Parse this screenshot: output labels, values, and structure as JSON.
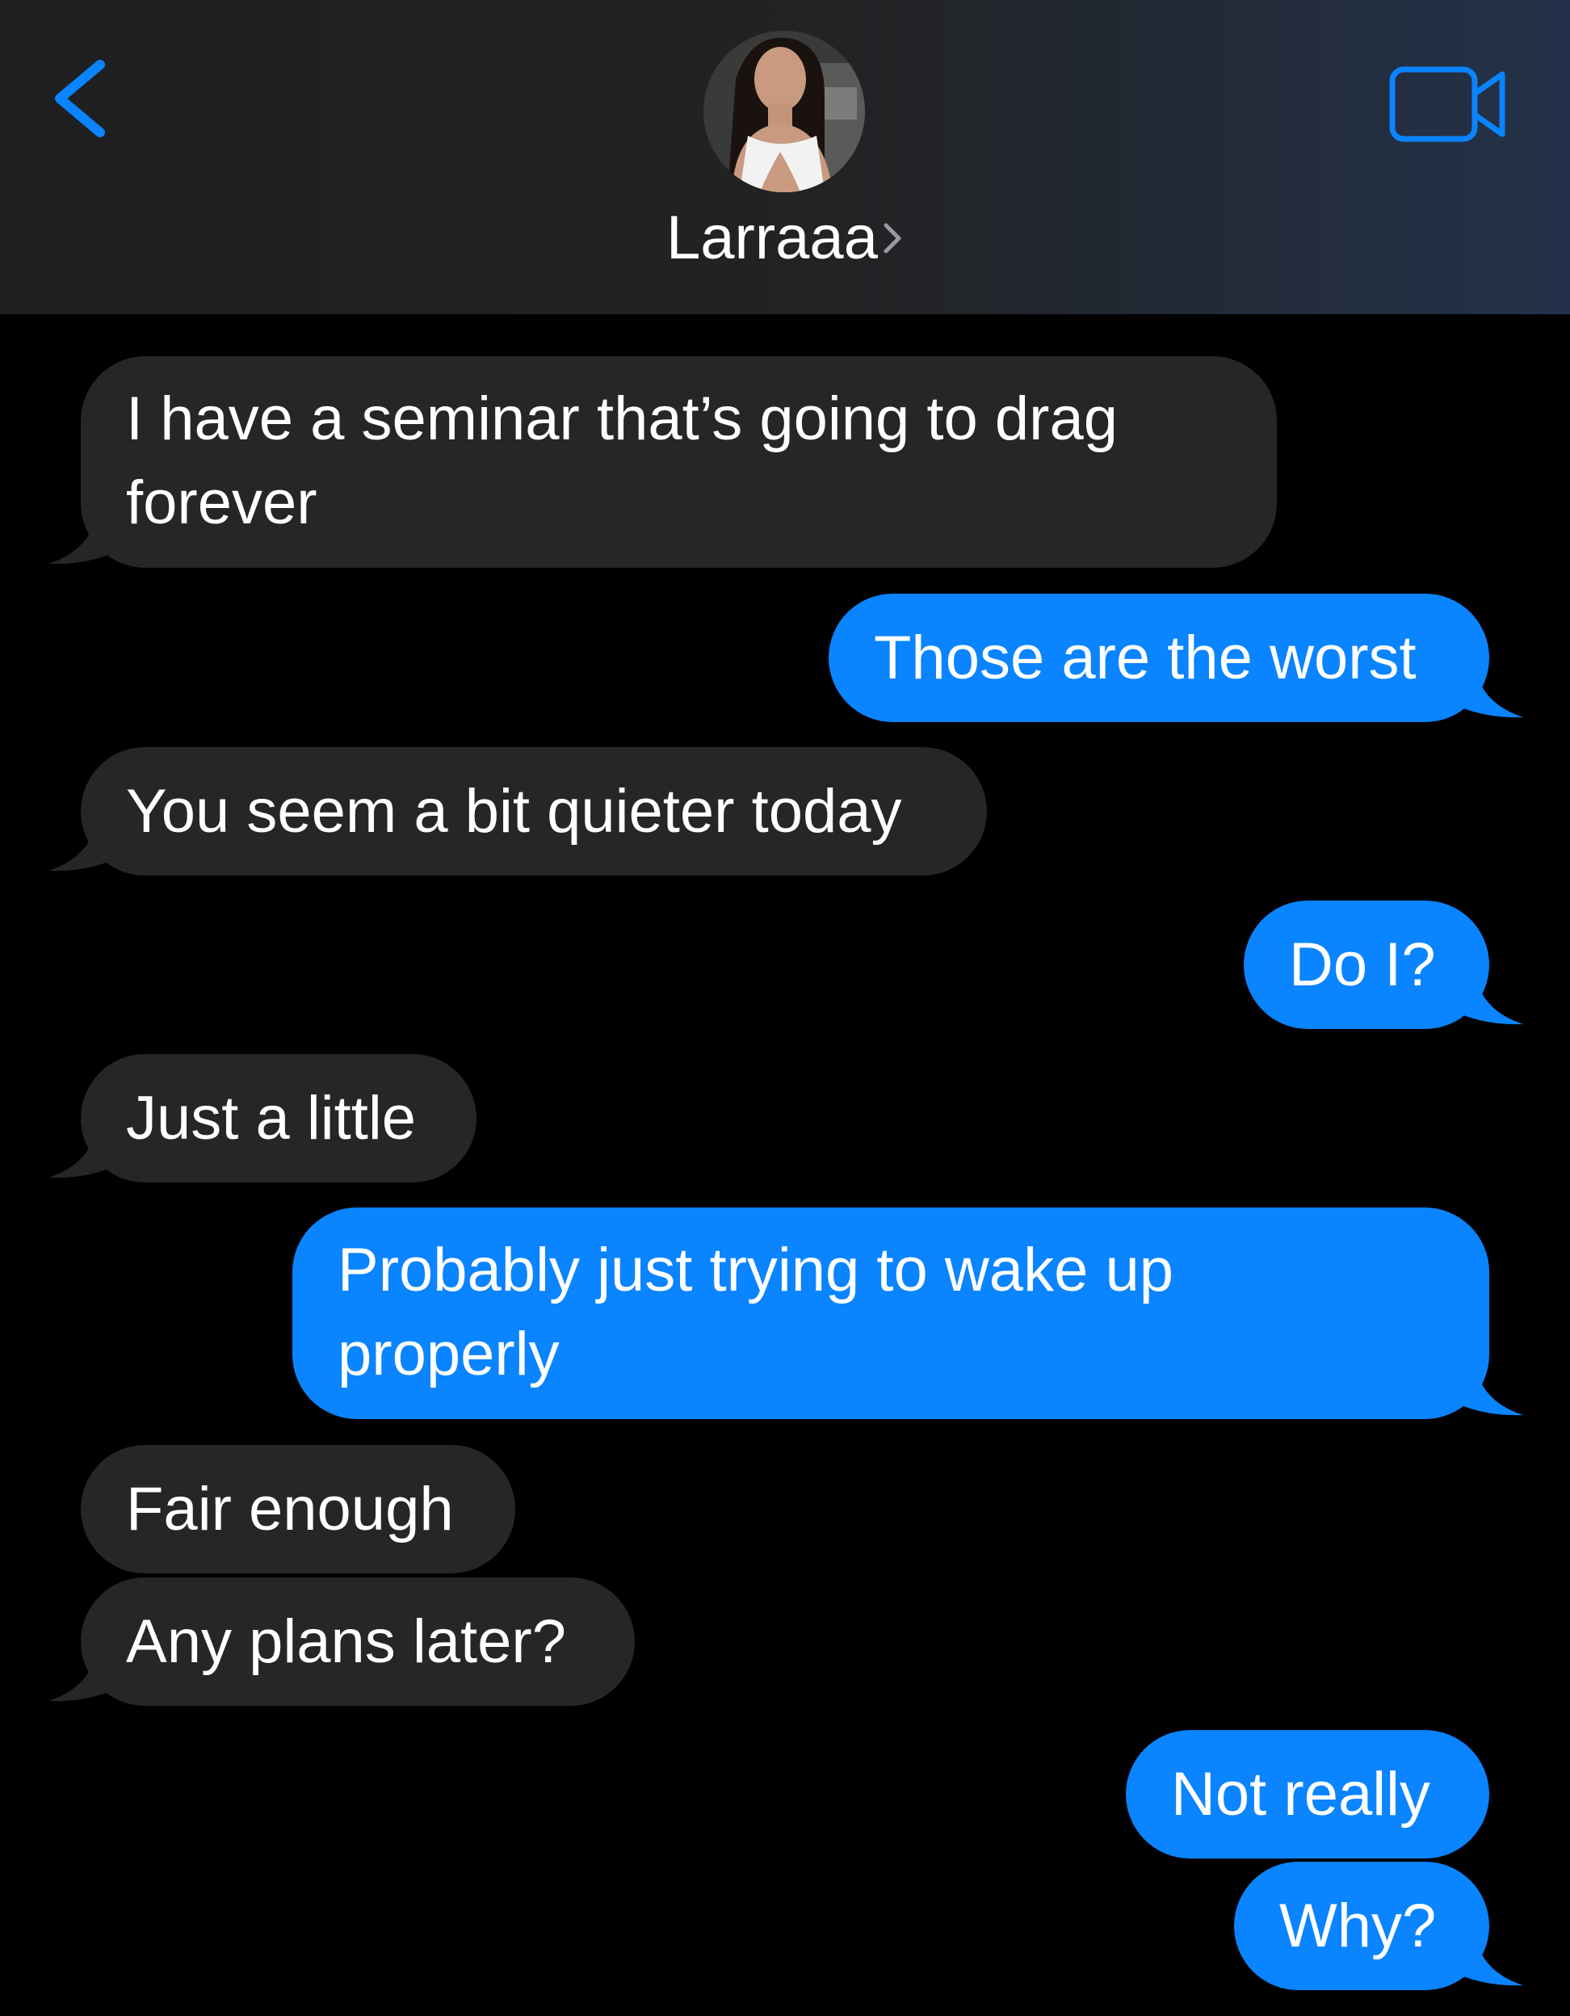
{
  "header": {
    "contact_name": "Larraaa",
    "back_icon": "chevron-left-icon",
    "video_icon": "video-camera-icon",
    "accent_color": "#0a84ff"
  },
  "messages": [
    {
      "from": "contact",
      "lines": [
        "I have a seminar that’s going to drag",
        "forever"
      ]
    },
    {
      "from": "me",
      "lines": [
        "Those are the worst"
      ]
    },
    {
      "from": "contact",
      "lines": [
        "You seem a bit quieter today"
      ]
    },
    {
      "from": "me",
      "lines": [
        "Do I?"
      ]
    },
    {
      "from": "contact",
      "lines": [
        "Just a little"
      ]
    },
    {
      "from": "me",
      "lines": [
        "Probably just trying to wake up",
        "properly"
      ]
    },
    {
      "from": "contact",
      "lines": [
        "Fair enough"
      ]
    },
    {
      "from": "contact",
      "lines": [
        "Any plans later?"
      ]
    },
    {
      "from": "me",
      "lines": [
        "Not really"
      ]
    },
    {
      "from": "me",
      "lines": [
        "Why?"
      ]
    }
  ],
  "colors": {
    "incoming_bubble": "#262628",
    "outgoing_bubble": "#0a84ff",
    "background": "#000000"
  }
}
